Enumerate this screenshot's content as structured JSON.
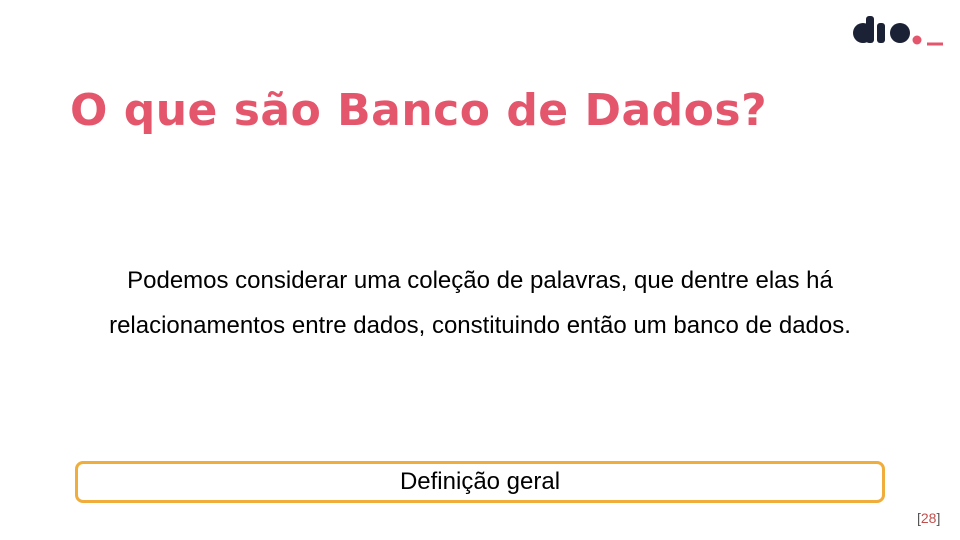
{
  "slide": {
    "title": "O que são Banco de Dados?",
    "body": "Podemos considerar uma coleção de palavras, que dentre elas há relacionamentos entre dados, constituindo então um banco de dados.",
    "definition_label": "Definição geral",
    "page_number": "28",
    "page_number_open": "[",
    "page_number_close": "]"
  },
  "logo": {
    "text": "dio._"
  },
  "colors": {
    "title": "#e4566c",
    "box_border": "#f0ad3c",
    "logo_dark": "#1b2236",
    "logo_accent": "#e4566c",
    "page_number": "#c0504d"
  }
}
